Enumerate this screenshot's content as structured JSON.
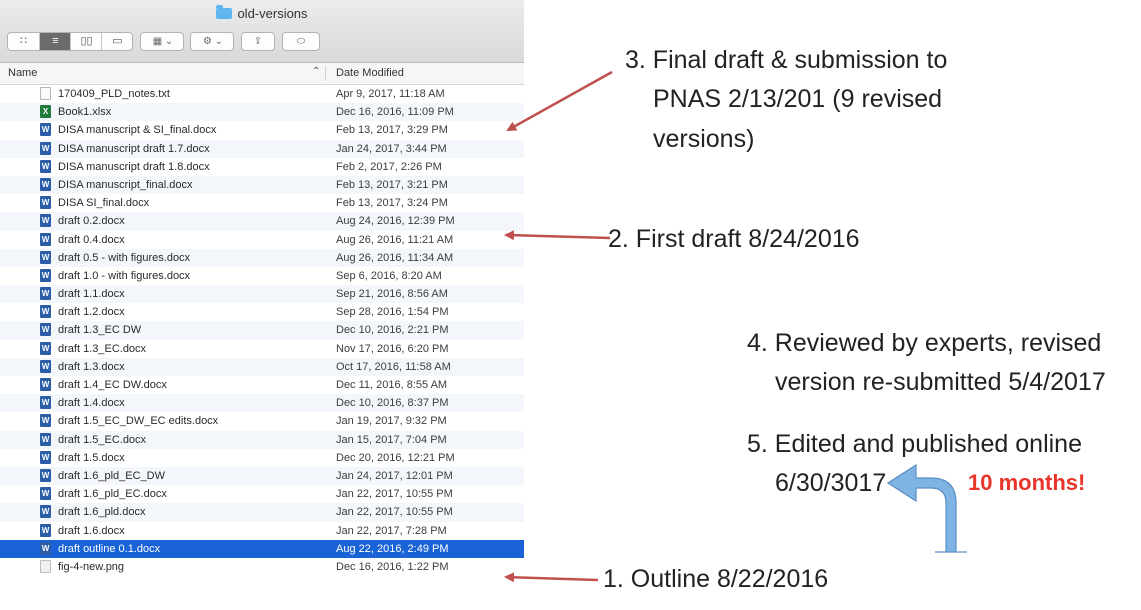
{
  "window": {
    "title": "old-versions",
    "folder_icon": "folder-icon",
    "accent_color": "#1a63d6"
  },
  "toolbar": {
    "view_icons": [
      "icon-view-icon",
      "list-view-icon",
      "column-view-icon",
      "cover-flow-icon"
    ],
    "arrange_icon": "arrange-grid-icon",
    "action_icon": "gear-icon",
    "share_icon": "share-icon",
    "tag_icon": "tag-icon"
  },
  "columns": {
    "name": "Name",
    "date": "Date Modified"
  },
  "files": [
    {
      "name": "170409_PLD_notes.txt",
      "date": "Apr 9, 2017, 11:18 AM",
      "type": "txt"
    },
    {
      "name": "Book1.xlsx",
      "date": "Dec 16, 2016, 11:09 PM",
      "type": "xlsx"
    },
    {
      "name": "DISA manuscript & SI_final.docx",
      "date": "Feb 13, 2017, 3:29 PM",
      "type": "docx"
    },
    {
      "name": "DISA manuscript draft 1.7.docx",
      "date": "Jan 24, 2017, 3:44 PM",
      "type": "docx"
    },
    {
      "name": "DISA manuscript draft 1.8.docx",
      "date": "Feb 2, 2017, 2:26 PM",
      "type": "docx"
    },
    {
      "name": "DISA manuscript_final.docx",
      "date": "Feb 13, 2017, 3:21 PM",
      "type": "docx"
    },
    {
      "name": "DISA SI_final.docx",
      "date": "Feb 13, 2017, 3:24 PM",
      "type": "docx"
    },
    {
      "name": "draft 0.2.docx",
      "date": "Aug 24, 2016, 12:39 PM",
      "type": "docx"
    },
    {
      "name": "draft 0.4.docx",
      "date": "Aug 26, 2016, 11:21 AM",
      "type": "docx"
    },
    {
      "name": "draft 0.5 - with figures.docx",
      "date": "Aug 26, 2016, 11:34 AM",
      "type": "docx"
    },
    {
      "name": "draft 1.0 - with figures.docx",
      "date": "Sep 6, 2016, 8:20 AM",
      "type": "docx"
    },
    {
      "name": "draft 1.1.docx",
      "date": "Sep 21, 2016, 8:56 AM",
      "type": "docx"
    },
    {
      "name": "draft 1.2.docx",
      "date": "Sep 28, 2016, 1:54 PM",
      "type": "docx"
    },
    {
      "name": "draft 1.3_EC DW",
      "date": "Dec 10, 2016, 2:21 PM",
      "type": "docx"
    },
    {
      "name": "draft 1.3_EC.docx",
      "date": "Nov 17, 2016, 6:20 PM",
      "type": "docx"
    },
    {
      "name": "draft 1.3.docx",
      "date": "Oct 17, 2016, 11:58 AM",
      "type": "docx"
    },
    {
      "name": "draft 1.4_EC DW.docx",
      "date": "Dec 11, 2016, 8:55 AM",
      "type": "docx"
    },
    {
      "name": "draft 1.4.docx",
      "date": "Dec 10, 2016, 8:37 PM",
      "type": "docx"
    },
    {
      "name": "draft 1.5_EC_DW_EC edits.docx",
      "date": "Jan 19, 2017, 9:32 PM",
      "type": "docx"
    },
    {
      "name": "draft 1.5_EC.docx",
      "date": "Jan 15, 2017, 7:04 PM",
      "type": "docx"
    },
    {
      "name": "draft 1.5.docx",
      "date": "Dec 20, 2016, 12:21 PM",
      "type": "docx"
    },
    {
      "name": "draft 1.6_pld_EC_DW",
      "date": "Jan 24, 2017, 12:01 PM",
      "type": "docx"
    },
    {
      "name": "draft 1.6_pld_EC.docx",
      "date": "Jan 22, 2017, 10:55 PM",
      "type": "docx"
    },
    {
      "name": "draft 1.6_pld.docx",
      "date": "Jan 22, 2017, 10:55 PM",
      "type": "docx"
    },
    {
      "name": "draft 1.6.docx",
      "date": "Jan 22, 2017, 7:28 PM",
      "type": "docx"
    },
    {
      "name": "draft outline 0.1.docx",
      "date": "Aug 22, 2016, 2:49 PM",
      "type": "docx",
      "selected": true
    },
    {
      "name": "fig-4-new.png",
      "date": "Dec 16, 2016, 1:22 PM",
      "type": "png"
    }
  ],
  "annotations": {
    "note3_line1": "3. Final draft & submission to",
    "note3_line2": "PNAS 2/13/201 (9 revised",
    "note3_line3": "versions)",
    "note2": "2. First draft 8/24/2016",
    "note4_line1": "4. Reviewed by experts, revised",
    "note4_line2": "version re-submitted 5/4/2017",
    "note5_line1": "5. Edited and published online",
    "note5_line2": "6/30/3017",
    "note1": "1. Outline 8/22/2016",
    "callout": "10 months!",
    "arrow_color": "#c0504d",
    "curved_arrow_color": "#6fa8dc",
    "callout_color": "#e8352b"
  }
}
